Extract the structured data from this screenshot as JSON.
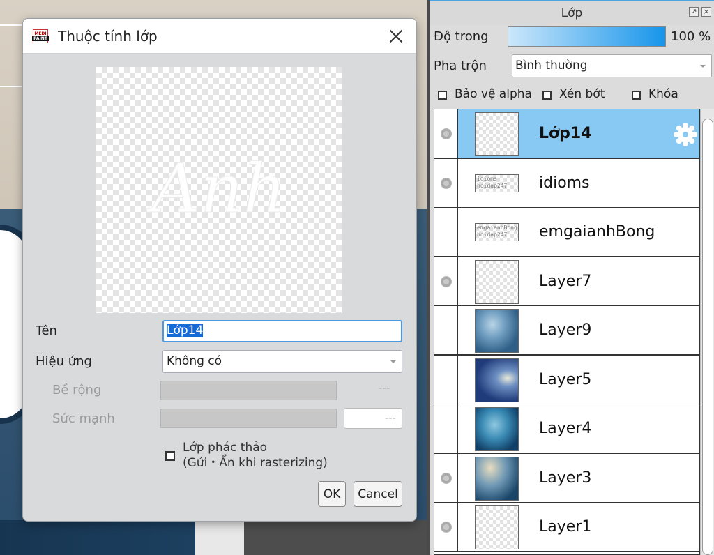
{
  "dialog": {
    "title": "Thuộc tính lớp",
    "app_icon_top": "MEDI",
    "app_icon_bottom": "PAINT",
    "preview_text": "Anh",
    "name_label": "Tên",
    "name_value": "Lớp14",
    "effect_label": "Hiệu ứng",
    "effect_value": "Không có",
    "width_label": "Bề rộng",
    "width_value": "---",
    "strength_label": "Sức mạnh",
    "strength_value": "---",
    "draft_line1": "Lớp phác thảo",
    "draft_line2": "(Gửi・Ẩn khi rasterizing)",
    "draft_checked": false,
    "ok_label": "OK",
    "cancel_label": "Cancel"
  },
  "panel": {
    "title": "Lớp",
    "opacity_label": "Độ trong",
    "opacity_value": "100 %",
    "opacity_fraction": 1.0,
    "blend_label": "Pha trộn",
    "blend_value": "Bình thường",
    "checks": [
      {
        "label": "Bảo vệ alpha",
        "checked": false
      },
      {
        "label": "Xén bớt",
        "checked": false
      },
      {
        "label": "Khóa",
        "checked": false
      }
    ],
    "layers": [
      {
        "name": "Lớp14",
        "selected": true,
        "visible_dot": true,
        "thumb": "transparent"
      },
      {
        "name": "idioms",
        "selected": false,
        "visible_dot": true,
        "thumb": "text",
        "thumb_text": "idioms hoidap247"
      },
      {
        "name": "emgaianhBong",
        "selected": false,
        "visible_dot": false,
        "thumb": "text",
        "thumb_text": "emgaianhBong hoidap247"
      },
      {
        "name": "Layer7",
        "selected": false,
        "visible_dot": true,
        "thumb": "transparent"
      },
      {
        "name": "Layer9",
        "selected": false,
        "visible_dot": false,
        "thumb": "cloud1"
      },
      {
        "name": "Layer5",
        "selected": false,
        "visible_dot": false,
        "thumb": "cloud2"
      },
      {
        "name": "Layer4",
        "selected": false,
        "visible_dot": false,
        "thumb": "cloud3"
      },
      {
        "name": "Layer3",
        "selected": false,
        "visible_dot": true,
        "thumb": "cloud4"
      },
      {
        "name": "Layer1",
        "selected": false,
        "visible_dot": true,
        "thumb": "transparent"
      }
    ]
  },
  "colors": {
    "selection": "#88c9f3",
    "accent": "#1795ea"
  }
}
